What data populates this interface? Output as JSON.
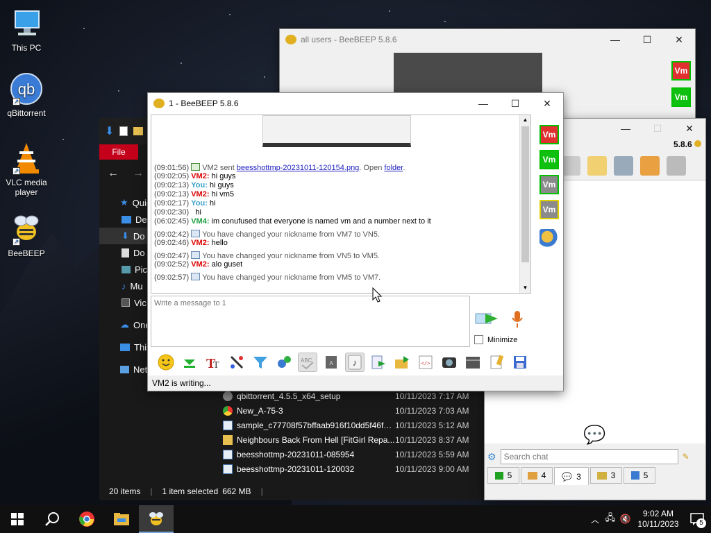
{
  "desktop": {
    "icons": [
      {
        "label": "This PC"
      },
      {
        "label": "qBittorrent"
      },
      {
        "label": "VLC media player"
      },
      {
        "label": "BeeBEEP"
      }
    ]
  },
  "explorer": {
    "ribbon_file": "File",
    "sidebar": [
      {
        "label": "Quic"
      },
      {
        "label": "De"
      },
      {
        "label": "Do"
      },
      {
        "label": "Do"
      },
      {
        "label": "Pic"
      },
      {
        "label": "Mu"
      },
      {
        "label": "Vic"
      },
      {
        "label": "One"
      },
      {
        "label": "This"
      },
      {
        "label": "Netv"
      }
    ],
    "files": [
      {
        "name": "qbittorrent_4.5.5_x64_setup",
        "date": "10/11/2023 7:17 AM"
      },
      {
        "name": "New_A-75-3",
        "date": "10/11/2023 7:03 AM"
      },
      {
        "name": "sample_c77708f57bffaab916f10dd5f46f99...",
        "date": "10/11/2023 5:12 AM"
      },
      {
        "name": "Neighbours Back From Hell [FitGirl Repa...",
        "date": "10/11/2023 8:37 AM"
      },
      {
        "name": "beesshottmp-20231011-085954",
        "date": "10/11/2023 5:59 AM"
      },
      {
        "name": "beesshottmp-20231011-120032",
        "date": "10/11/2023 9:00 AM"
      }
    ],
    "status": {
      "items": "20 items",
      "selected": "1 item selected",
      "size": "662 MB"
    }
  },
  "allusers_window": {
    "title": "all users - BeeBEEP 5.8.6",
    "users": [
      "Vm",
      "Vm",
      "Vm"
    ]
  },
  "main_window": {
    "version": "5.8.6",
    "search_placeholder": "Search chat",
    "tabs": [
      {
        "count": "5"
      },
      {
        "count": "4"
      },
      {
        "count": "3"
      },
      {
        "count": "3"
      },
      {
        "count": "5"
      }
    ]
  },
  "chat_window": {
    "title": "1 - BeeBEEP 5.8.6",
    "users": [
      "Vm",
      "Vm",
      "Vm",
      "Vm"
    ],
    "messages": [
      {
        "time": "(09:01:56)",
        "kind": "file",
        "pre": "VM2 sent ",
        "file": "beesshottmp-20231011-120154.png",
        "mid": ". Open ",
        "folder": "folder",
        "post": "."
      },
      {
        "time": "(09:02:05)",
        "kind": "msg",
        "who": "VM2",
        "cls": "vm2",
        "text": "hi guys"
      },
      {
        "time": "(09:02:13)",
        "kind": "msg",
        "who": "You",
        "cls": "you",
        "text": "hi guys"
      },
      {
        "time": "(09:02:13)",
        "kind": "msg",
        "who": "VM2",
        "cls": "vm2",
        "text": "hi vm5"
      },
      {
        "time": "(09:02:17)",
        "kind": "msg",
        "who": "You",
        "cls": "you",
        "text": "hi"
      },
      {
        "time": "(09:02:30)",
        "kind": "plain",
        "text": "hi"
      },
      {
        "time": "(06:02:45)",
        "kind": "msg",
        "who": "VM4",
        "cls": "vm4",
        "text": "im conufused that everyone is named vm and a number next to it"
      },
      {
        "time": "(09:02:42)",
        "kind": "sys",
        "text": "You have changed your nickname from VM7 to VN5."
      },
      {
        "time": "(09:02:46)",
        "kind": "msg",
        "who": "VM2",
        "cls": "vm2",
        "text": "hello"
      },
      {
        "time": "(09:02:47)",
        "kind": "sys",
        "text": "You have changed your nickname from VN5 to VM5."
      },
      {
        "time": "(09:02:52)",
        "kind": "msg",
        "who": "VM2",
        "cls": "vm2",
        "text": "alo guset"
      },
      {
        "time": "(09:02:57)",
        "kind": "sys",
        "text": "You have changed your nickname from VM5 to VM7."
      }
    ],
    "compose_placeholder": "Write a message to 1",
    "minimize_label": "Minimize",
    "status": "VM2 is writing..."
  },
  "taskbar": {
    "time": "9:02 AM",
    "date": "10/11/2023",
    "notifications": "5"
  },
  "colors": {
    "accent_red": "#c4001a",
    "vm_green": "#10c010",
    "vm_red": "#e03030",
    "taskbar": "#101010"
  }
}
